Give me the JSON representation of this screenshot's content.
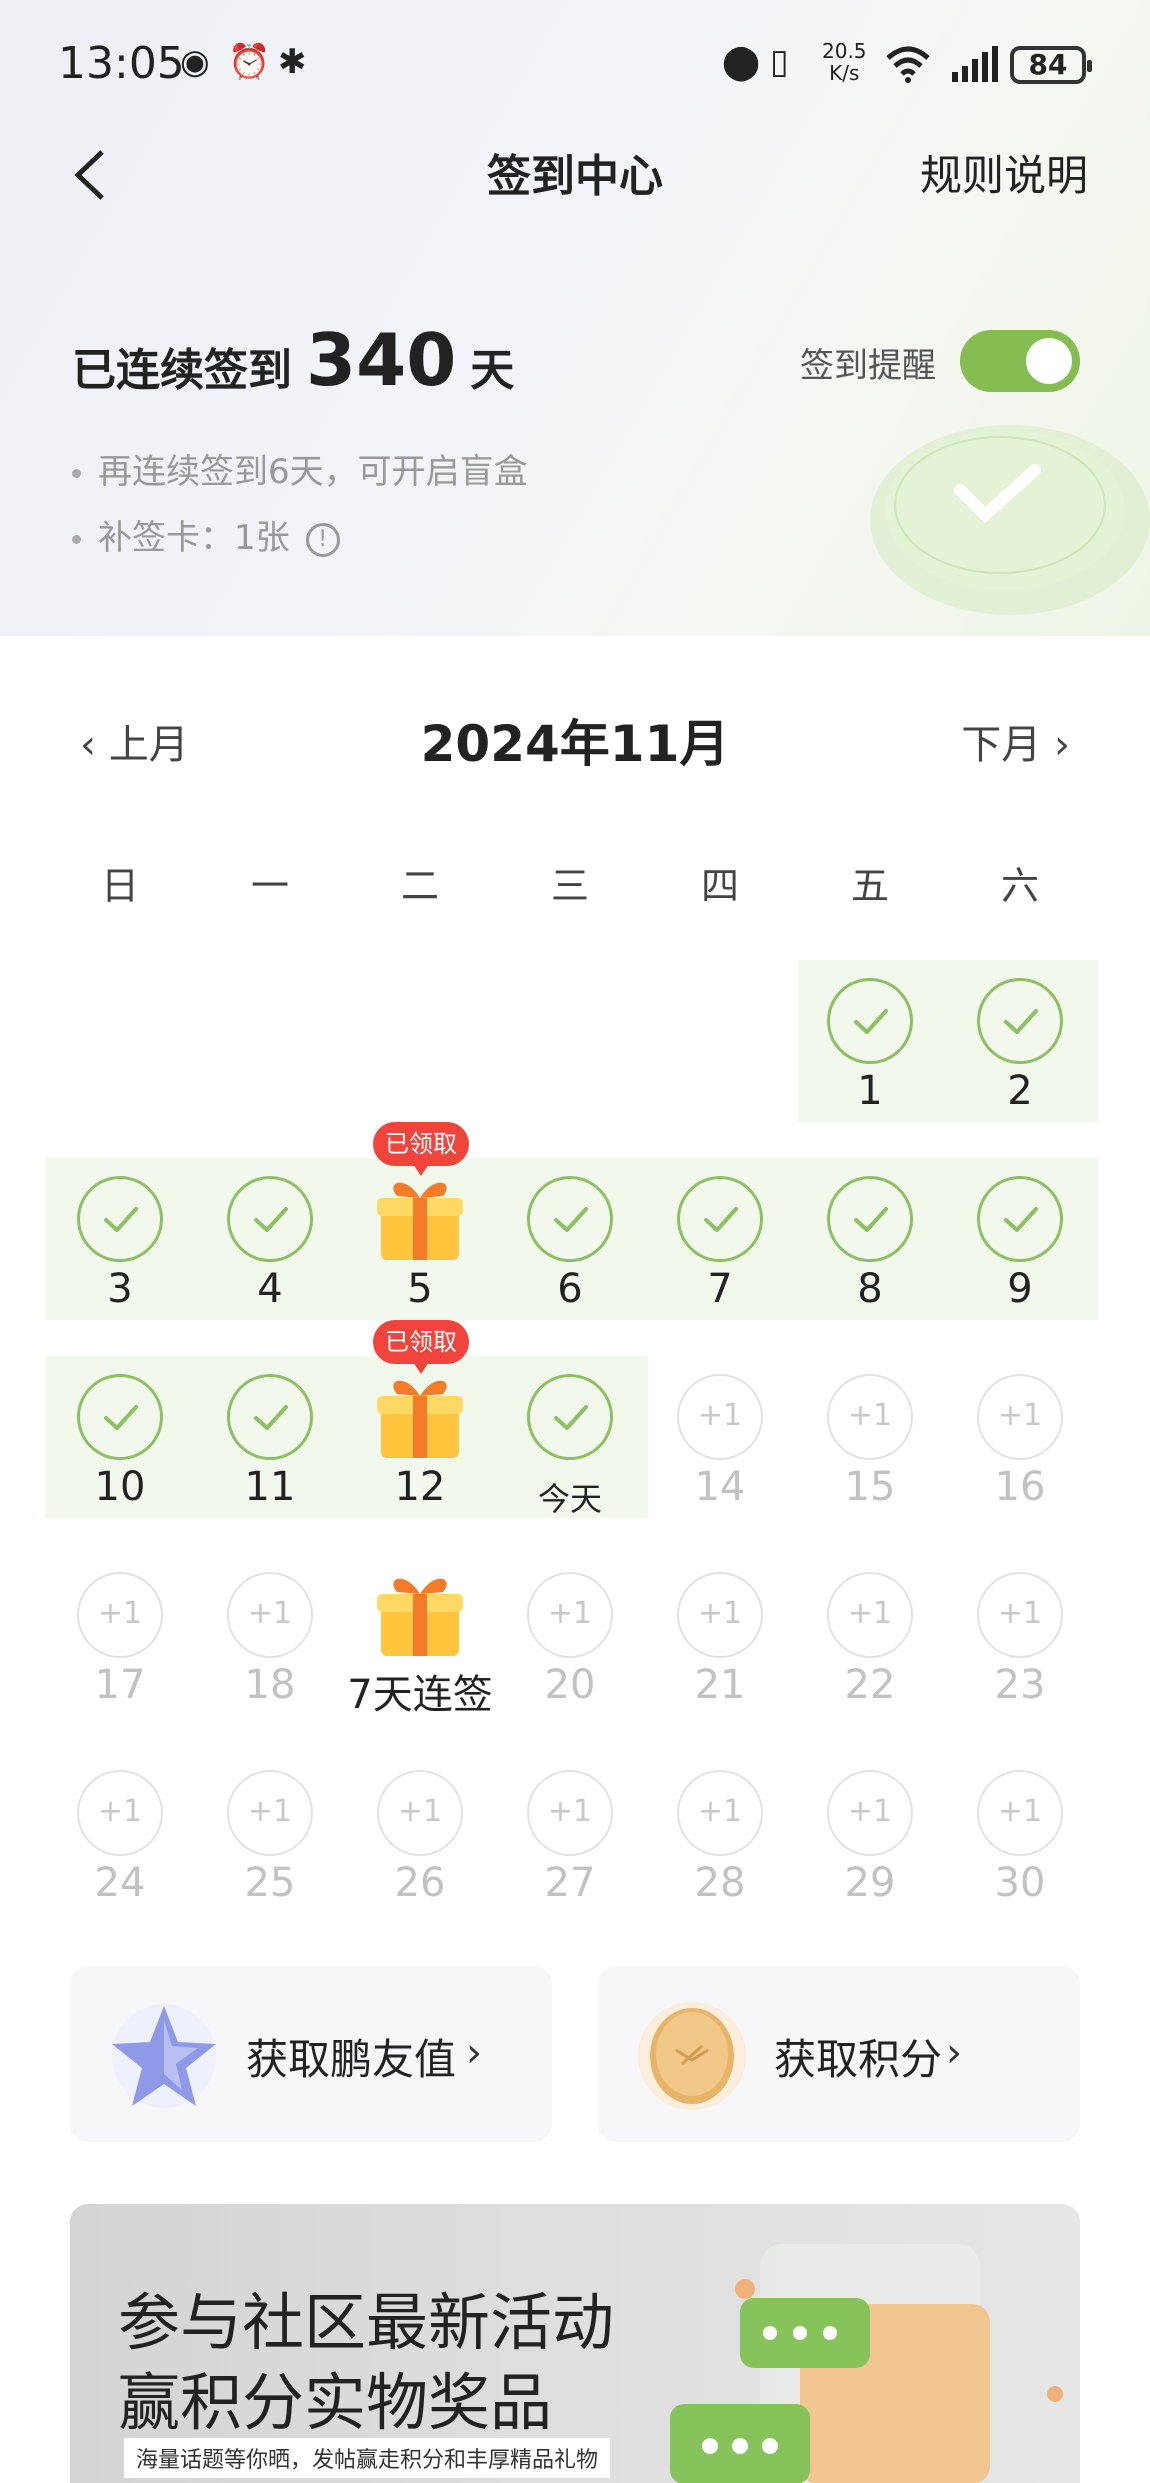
{
  "status": {
    "time": "13:05",
    "speed_value": "20.5",
    "speed_unit": "K/s",
    "battery": "84"
  },
  "nav": {
    "title": "签到中心",
    "rules_label": "规则说明"
  },
  "streak": {
    "prefix": "已连续签到",
    "days": "340",
    "suffix": "天"
  },
  "reminder": {
    "label": "签到提醒",
    "enabled": true
  },
  "bullets": [
    "再连续签到6天，可开启盲盒",
    "补签卡：1张"
  ],
  "month": {
    "prev": "上月",
    "current": "2024年11月",
    "next": "下月"
  },
  "weekdays": [
    "日",
    "一",
    "二",
    "三",
    "四",
    "五",
    "六"
  ],
  "calendar": {
    "claimed_label": "已领取",
    "plus_label": "+1",
    "days": [
      {
        "day": "1",
        "status": "done"
      },
      {
        "day": "2",
        "status": "done"
      },
      {
        "day": "3",
        "status": "done"
      },
      {
        "day": "4",
        "status": "done"
      },
      {
        "day": "5",
        "status": "gift_claimed"
      },
      {
        "day": "6",
        "status": "done"
      },
      {
        "day": "7",
        "status": "done"
      },
      {
        "day": "8",
        "status": "done"
      },
      {
        "day": "9",
        "status": "done"
      },
      {
        "day": "10",
        "status": "done"
      },
      {
        "day": "11",
        "status": "done"
      },
      {
        "day": "12",
        "status": "gift_claimed"
      },
      {
        "day": "今天",
        "status": "done"
      },
      {
        "day": "14",
        "status": "todo"
      },
      {
        "day": "15",
        "status": "todo"
      },
      {
        "day": "16",
        "status": "todo"
      },
      {
        "day": "17",
        "status": "todo"
      },
      {
        "day": "18",
        "status": "todo"
      },
      {
        "day": "7天连签",
        "status": "gift"
      },
      {
        "day": "20",
        "status": "todo"
      },
      {
        "day": "21",
        "status": "todo"
      },
      {
        "day": "22",
        "status": "todo"
      },
      {
        "day": "23",
        "status": "todo"
      },
      {
        "day": "24",
        "status": "todo"
      },
      {
        "day": "25",
        "status": "todo"
      },
      {
        "day": "26",
        "status": "todo"
      },
      {
        "day": "27",
        "status": "todo"
      },
      {
        "day": "28",
        "status": "todo"
      },
      {
        "day": "29",
        "status": "todo"
      },
      {
        "day": "30",
        "status": "todo"
      }
    ]
  },
  "cards": {
    "friend_value": "获取鹏友值",
    "points": "获取积分"
  },
  "banner": {
    "line1": "参与社区最新活动",
    "line2": "赢积分实物奖品",
    "sub": "海量话题等你晒，发帖赢走积分和丰厚精品礼物"
  },
  "colors": {
    "accent_green": "#85bd52",
    "check_green": "#8cc063",
    "badge_red": "#f0443c"
  }
}
